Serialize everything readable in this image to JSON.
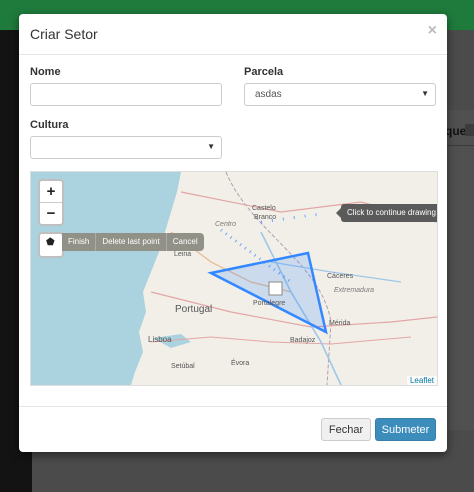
{
  "background": {
    "side_text": "que"
  },
  "modal": {
    "title": "Criar Setor",
    "close_glyph": "×"
  },
  "form": {
    "nome": {
      "label": "Nome",
      "value": ""
    },
    "parcela": {
      "label": "Parcela",
      "value": "asdas"
    },
    "cultura": {
      "label": "Cultura",
      "value": ""
    }
  },
  "map": {
    "zoom_in": "+",
    "zoom_out": "−",
    "draw_polygon_icon": "polygon-icon",
    "draw_actions": [
      "Finish",
      "Delete last point",
      "Cancel"
    ],
    "tooltip": "Click to continue drawing shape.",
    "attribution": "Leaflet",
    "places": {
      "portugal": "Portugal",
      "lisboa": "Lisboa",
      "leiria": "Leiria",
      "centro": "Centro",
      "castelo_branco": "Castelo Branco",
      "portalegre": "Portalegre",
      "caceres": "Cáceres",
      "extremadura": "Extremadura",
      "merida": "Mérida",
      "badajoz": "Badajoz",
      "evora": "Évora",
      "setubal": "Setúbal"
    }
  },
  "footer": {
    "close_label": "Fechar",
    "submit_label": "Submeter"
  },
  "colors": {
    "header_green": "#1e7b3c",
    "submit_blue": "#3c8dbc",
    "polygon_blue": "#3388ff",
    "sea": "#aad3df"
  }
}
